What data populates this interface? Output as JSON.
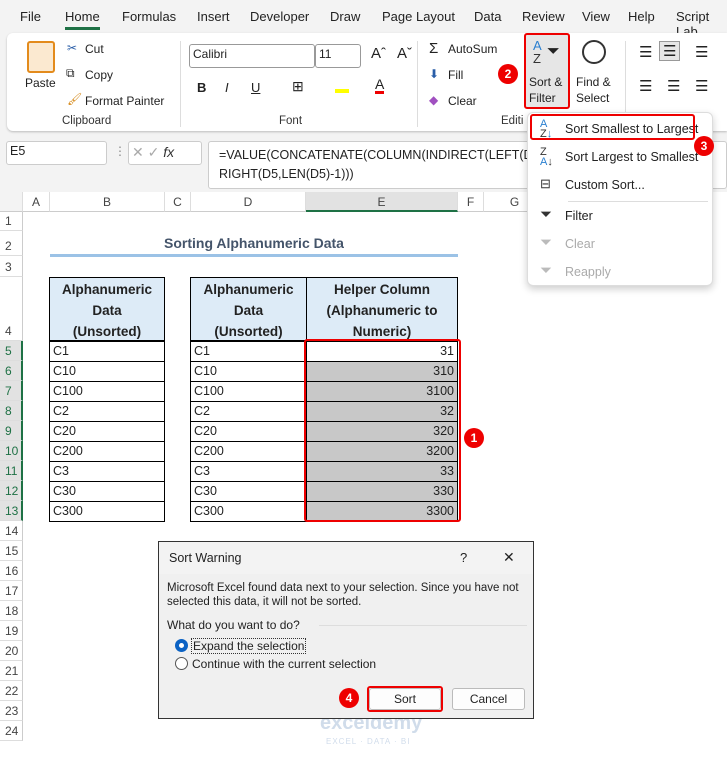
{
  "tabs": [
    "File",
    "Home",
    "Formulas",
    "Insert",
    "Developer",
    "Draw",
    "Page Layout",
    "Data",
    "Review",
    "View",
    "Help",
    "Script Lab"
  ],
  "ribbon": {
    "clipboard": {
      "paste": "Paste",
      "cut": "Cut",
      "copy": "Copy",
      "format_painter": "Format Painter",
      "group": "Clipboard"
    },
    "font": {
      "name": "Calibri",
      "size": "11",
      "group": "Font",
      "bold": "B",
      "italic": "I",
      "underline": "U"
    },
    "editing": {
      "autosum": "AutoSum",
      "fill": "Fill",
      "clear": "Clear",
      "group": "Editi",
      "sort_filter_1": "Sort &",
      "sort_filter_2": "Filter",
      "find_select_1": "Find &",
      "find_select_2": "Select"
    }
  },
  "formula_bar": {
    "name_box": "E5",
    "fx": "fx",
    "formula_line1": "=VALUE(CONCATENATE(COLUMN(INDIRECT(LEFT(D",
    "formula_line2": "RIGHT(D5,LEN(D5)-1)))"
  },
  "columns": [
    "A",
    "B",
    "C",
    "D",
    "E",
    "F",
    "G"
  ],
  "rows": [
    "1",
    "2",
    "3",
    "4",
    "5",
    "6",
    "7",
    "8",
    "9",
    "10",
    "11",
    "12",
    "13",
    "14",
    "15",
    "16",
    "17",
    "18",
    "19",
    "20",
    "21",
    "22",
    "23",
    "24"
  ],
  "sheet": {
    "title": "Sorting Alphanumeric Data",
    "table1_header": [
      "Alphanumeric",
      "Data",
      "(Unsorted)"
    ],
    "table2_header_d": [
      "Alphanumeric",
      "Data",
      "(Unsorted)"
    ],
    "table2_header_e": [
      "Helper Column",
      "(Alphanumeric to",
      "Numeric)"
    ],
    "data": [
      "C1",
      "C10",
      "C100",
      "C2",
      "C20",
      "C200",
      "C3",
      "C30",
      "C300"
    ],
    "helper": [
      "31",
      "310",
      "3100",
      "32",
      "320",
      "3200",
      "33",
      "330",
      "3300"
    ]
  },
  "sort_menu": {
    "items": [
      {
        "label": "Sort Smallest to Largest",
        "icon": "sort-ascending-icon"
      },
      {
        "label": "Sort Largest to Smallest",
        "icon": "sort-descending-icon"
      },
      {
        "label": "Custom Sort...",
        "icon": "custom-sort-icon"
      },
      {
        "label": "Filter",
        "icon": "filter-icon"
      },
      {
        "label": "Clear",
        "icon": "clear-filter-icon",
        "disabled": true
      },
      {
        "label": "Reapply",
        "icon": "reapply-icon",
        "disabled": true
      }
    ]
  },
  "dialog": {
    "title": "Sort Warning",
    "help": "?",
    "close": "✕",
    "message_line1": "Microsoft Excel found data next to your selection.  Since you have not",
    "message_line2": "selected this data, it will not be sorted.",
    "question": "What do you want to do?",
    "option1": "Expand the selection",
    "option2": "Continue with the current selection",
    "selected_option": "Expand the selection",
    "sort": "Sort",
    "cancel": "Cancel"
  },
  "badges": [
    "1",
    "2",
    "3",
    "4"
  ],
  "watermark": {
    "brand": "exceldemy",
    "tagline": "EXCEL · DATA · BI"
  },
  "colors": {
    "accent": "#1e7145",
    "highlight": "#ee0000",
    "header_fill": "#ddebf7",
    "selection": "#c8c8c8"
  }
}
